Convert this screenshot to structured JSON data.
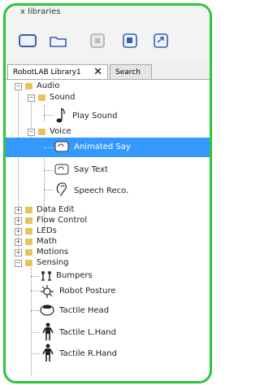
{
  "window": {
    "title": "x libraries"
  },
  "toolbar": {
    "buttons": [
      "new-icon",
      "open-icon",
      "disabled-icon",
      "save-icon",
      "export-icon"
    ]
  },
  "tabs": [
    {
      "label": "RobotLAB Library1"
    },
    {
      "label": "Search"
    }
  ],
  "tree": {
    "audio": "Audio",
    "sound": "Sound",
    "play_sound": "Play Sound",
    "voice": "Voice",
    "animated_say": "Animated Say",
    "say_text": "Say Text",
    "speech_reco": "Speech Reco.",
    "data_edit": "Data Edit",
    "flow_control": "Flow Control",
    "leds": "LEDs",
    "math": "Math",
    "motions": "Motions",
    "sensing": "Sensing",
    "bumpers": "Bumpers",
    "robot_posture": "Robot Posture",
    "tactile_head": "Tactile Head",
    "tactile_lhand": "Tactile L.Hand",
    "tactile_rhand": "Tactile R.Hand"
  }
}
